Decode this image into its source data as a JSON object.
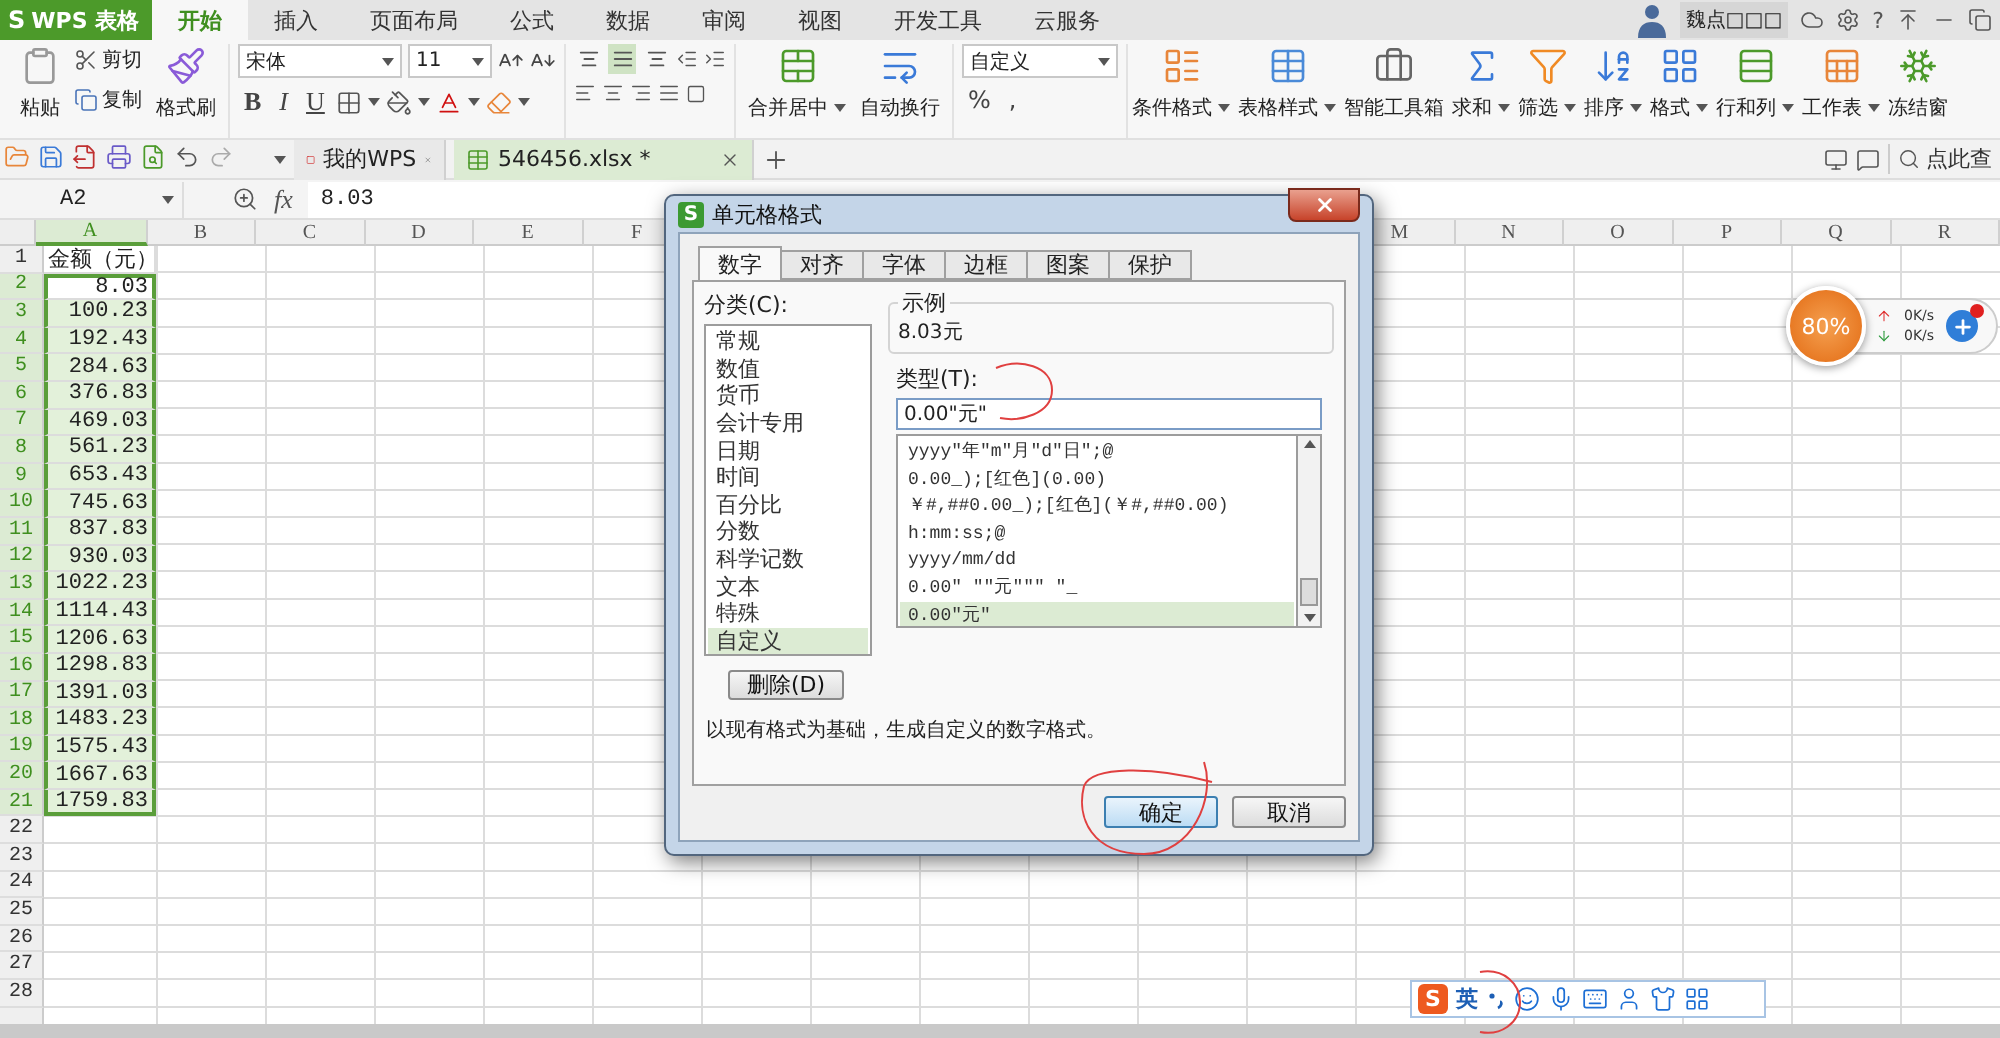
{
  "app": {
    "logo_mark": "S",
    "logo": "WPS 表格"
  },
  "menu_tabs": [
    {
      "label": "开始",
      "selected": true
    },
    {
      "label": "插入",
      "selected": false
    },
    {
      "label": "页面布局",
      "selected": false
    },
    {
      "label": "公式",
      "selected": false
    },
    {
      "label": "数据",
      "selected": false
    },
    {
      "label": "审阅",
      "selected": false
    },
    {
      "label": "视图",
      "selected": false
    },
    {
      "label": "开发工具",
      "selected": false
    },
    {
      "label": "云服务",
      "selected": false
    }
  ],
  "user": {
    "name": "魏点□□□",
    "help": "?"
  },
  "ribbon": {
    "paste": "粘贴",
    "cut": "剪切",
    "copy": "复制",
    "format_painter": "格式刷",
    "font": "宋体",
    "font_size": "11",
    "style_buttons": [
      "B",
      "I",
      "U"
    ],
    "vertical_align": [
      {
        "selected": false
      },
      {
        "selected": true
      },
      {
        "selected": false
      }
    ],
    "merge": "合并居中",
    "wrap": "自动换行",
    "number_format": "自定义",
    "percent": "%",
    "thousands": ",",
    "tools": [
      {
        "label": "条件格式",
        "dropdown": true
      },
      {
        "label": "表格样式",
        "dropdown": true
      },
      {
        "label": "智能工具箱",
        "dropdown": false
      },
      {
        "label": "求和",
        "dropdown": true
      },
      {
        "label": "筛选",
        "dropdown": true
      },
      {
        "label": "排序",
        "dropdown": true
      },
      {
        "label": "格式",
        "dropdown": true
      },
      {
        "label": "行和列",
        "dropdown": true
      },
      {
        "label": "工作表",
        "dropdown": true
      },
      {
        "label": "冻结窗",
        "dropdown": false
      }
    ]
  },
  "doc_tabs": [
    {
      "label": "我的WPS",
      "selected": false
    },
    {
      "label": "546456.xlsx *",
      "selected": true
    }
  ],
  "search": {
    "placeholder": "点此查"
  },
  "formula_bar": {
    "cell": "A2",
    "fx": "fx",
    "value": "8.03"
  },
  "sheet": {
    "columns": [
      {
        "label": "A",
        "selected": true
      },
      {
        "label": "B",
        "selected": false
      },
      {
        "label": "C",
        "selected": false
      },
      {
        "label": "D",
        "selected": false
      },
      {
        "label": "E",
        "selected": false
      },
      {
        "label": "F",
        "selected": false
      },
      {
        "label": "M",
        "selected": false
      },
      {
        "label": "N",
        "selected": false
      },
      {
        "label": "O",
        "selected": false
      },
      {
        "label": "P",
        "selected": false
      },
      {
        "label": "Q",
        "selected": false
      },
      {
        "label": "R",
        "selected": false
      }
    ],
    "rows": [
      {
        "number": "1",
        "kind": "text",
        "cells": [
          "金额（元）"
        ],
        "selected": false,
        "active": false
      },
      {
        "number": "2",
        "kind": "number",
        "cells": [
          "8.03"
        ],
        "selected": true,
        "active": true
      },
      {
        "number": "3",
        "kind": "number",
        "cells": [
          "100.23"
        ],
        "selected": true,
        "active": false
      },
      {
        "number": "4",
        "kind": "number",
        "cells": [
          "192.43"
        ],
        "selected": true,
        "active": false
      },
      {
        "number": "5",
        "kind": "number",
        "cells": [
          "284.63"
        ],
        "selected": true,
        "active": false
      },
      {
        "number": "6",
        "kind": "number",
        "cells": [
          "376.83"
        ],
        "selected": true,
        "active": false
      },
      {
        "number": "7",
        "kind": "number",
        "cells": [
          "469.03"
        ],
        "selected": true,
        "active": false
      },
      {
        "number": "8",
        "kind": "number",
        "cells": [
          "561.23"
        ],
        "selected": true,
        "active": false
      },
      {
        "number": "9",
        "kind": "number",
        "cells": [
          "653.43"
        ],
        "selected": true,
        "active": false
      },
      {
        "number": "10",
        "kind": "number",
        "cells": [
          "745.63"
        ],
        "selected": true,
        "active": false
      },
      {
        "number": "11",
        "kind": "number",
        "cells": [
          "837.83"
        ],
        "selected": true,
        "active": false
      },
      {
        "number": "12",
        "kind": "number",
        "cells": [
          "930.03"
        ],
        "selected": true,
        "active": false
      },
      {
        "number": "13",
        "kind": "number",
        "cells": [
          "1022.23"
        ],
        "selected": true,
        "active": false
      },
      {
        "number": "14",
        "kind": "number",
        "cells": [
          "1114.43"
        ],
        "selected": true,
        "active": false
      },
      {
        "number": "15",
        "kind": "number",
        "cells": [
          "1206.63"
        ],
        "selected": true,
        "active": false
      },
      {
        "number": "16",
        "kind": "number",
        "cells": [
          "1298.83"
        ],
        "selected": true,
        "active": false
      },
      {
        "number": "17",
        "kind": "number",
        "cells": [
          "1391.03"
        ],
        "selected": true,
        "active": false
      },
      {
        "number": "18",
        "kind": "number",
        "cells": [
          "1483.23"
        ],
        "selected": true,
        "active": false
      },
      {
        "number": "19",
        "kind": "number",
        "cells": [
          "1575.43"
        ],
        "selected": true,
        "active": false
      },
      {
        "number": "20",
        "kind": "number",
        "cells": [
          "1667.63"
        ],
        "selected": true,
        "active": false
      },
      {
        "number": "21",
        "kind": "number",
        "cells": [
          "1759.83"
        ],
        "selected": true,
        "active": false
      },
      {
        "number": "22",
        "cells": [],
        "selected": false,
        "active": false
      },
      {
        "number": "23",
        "cells": [],
        "selected": false,
        "active": false
      },
      {
        "number": "24",
        "cells": [],
        "selected": false,
        "active": false
      },
      {
        "number": "25",
        "cells": [],
        "selected": false,
        "active": false
      },
      {
        "number": "26",
        "cells": [],
        "selected": false,
        "active": false
      },
      {
        "number": "27",
        "cells": [],
        "selected": false,
        "active": false
      },
      {
        "number": "28",
        "cells": [],
        "selected": false,
        "active": false
      }
    ]
  },
  "dialog": {
    "icon_letter": "S",
    "title": "单元格格式",
    "tabs": [
      {
        "label": "数字",
        "selected": true
      },
      {
        "label": "对齐",
        "selected": false
      },
      {
        "label": "字体",
        "selected": false
      },
      {
        "label": "边框",
        "selected": false
      },
      {
        "label": "图案",
        "selected": false
      },
      {
        "label": "保护",
        "selected": false
      }
    ],
    "category_label": "分类(C):",
    "categories": [
      {
        "label": "常规",
        "selected": false
      },
      {
        "label": "数值",
        "selected": false
      },
      {
        "label": "货币",
        "selected": false
      },
      {
        "label": "会计专用",
        "selected": false
      },
      {
        "label": "日期",
        "selected": false
      },
      {
        "label": "时间",
        "selected": false
      },
      {
        "label": "百分比",
        "selected": false
      },
      {
        "label": "分数",
        "selected": false
      },
      {
        "label": "科学记数",
        "selected": false
      },
      {
        "label": "文本",
        "selected": false
      },
      {
        "label": "特殊",
        "selected": false
      },
      {
        "label": "自定义",
        "selected": true
      }
    ],
    "sample_label": "示例",
    "sample": "8.03元",
    "type_label": "类型(T):",
    "type_value": "0.00\"元\"",
    "formats": [
      {
        "label": "yyyy\"年\"m\"月\"d\"日\";@",
        "selected": false
      },
      {
        "label": "0.00_);[红色](0.00)",
        "selected": false
      },
      {
        "label": "￥#,##0.00_);[红色](￥#,##0.00)",
        "selected": false
      },
      {
        "label": "h:mm:ss;@",
        "selected": false
      },
      {
        "label": "yyyy/mm/dd",
        "selected": false
      },
      {
        "label": "0.00\" \"\"元\"\"\" \"_",
        "selected": false
      },
      {
        "label": "0.00\"元\"",
        "selected": true
      }
    ],
    "delete": "删除(D)",
    "description": "以现有格式为基础，生成自定义的数字格式。",
    "ok": "确定",
    "cancel": "取消"
  },
  "net_widget": {
    "percent": "80%",
    "up": "0K/s",
    "down": "0K/s"
  },
  "ime": {
    "logo": "S",
    "mode": "英"
  }
}
